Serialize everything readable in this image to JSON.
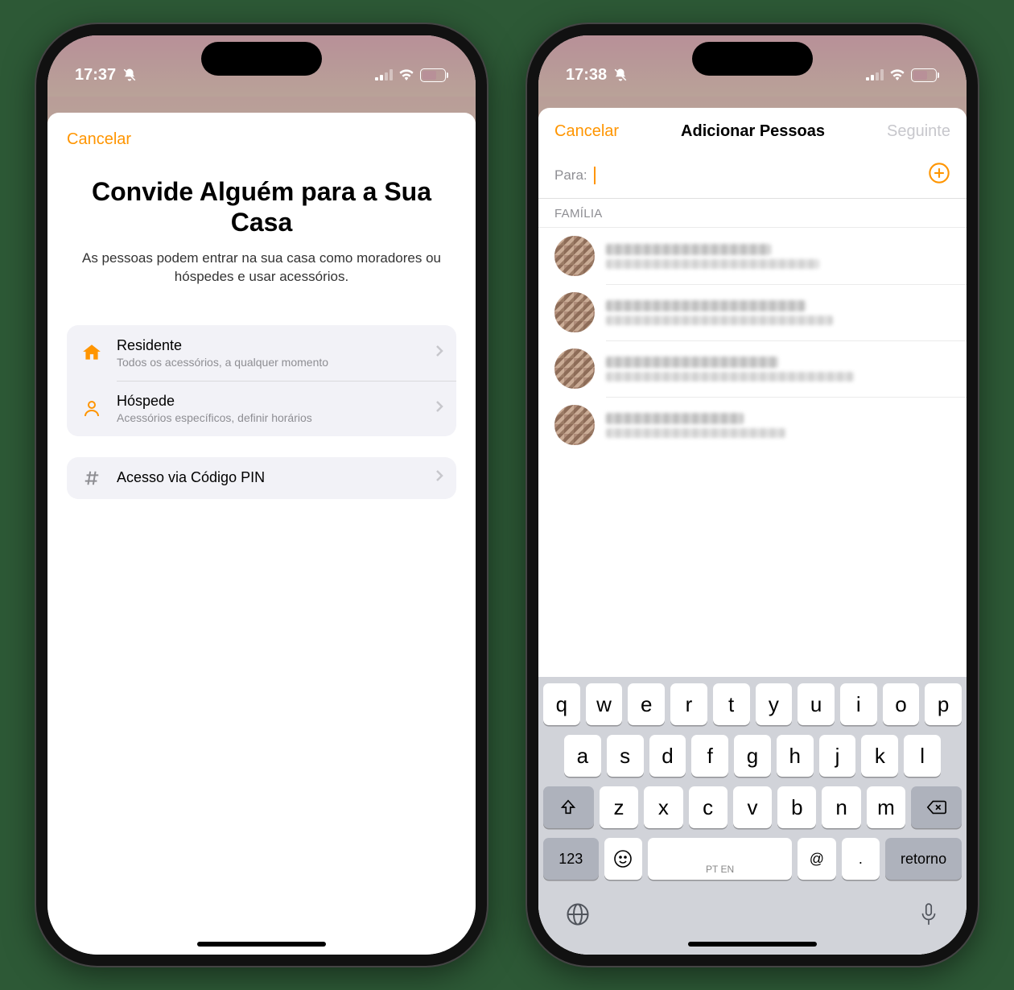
{
  "phone1": {
    "status": {
      "time": "17:37",
      "battery_pct": 64
    },
    "cancel": "Cancelar",
    "title": "Convide Alguém para a Sua Casa",
    "subtitle": "As pessoas podem entrar na sua casa como moradores ou hóspedes e usar acessórios.",
    "options": {
      "resident": {
        "title": "Residente",
        "sub": "Todos os acessórios, a qualquer momento"
      },
      "guest": {
        "title": "Hóspede",
        "sub": "Acessórios específicos, definir horários"
      },
      "pin": {
        "title": "Acesso via Código PIN"
      }
    }
  },
  "phone2": {
    "status": {
      "time": "17:38",
      "battery_pct": 64
    },
    "nav": {
      "cancel": "Cancelar",
      "title": "Adicionar Pessoas",
      "next": "Seguinte"
    },
    "to_label": "Para:",
    "section": "FAMÍLIA",
    "keyboard": {
      "row1": [
        "q",
        "w",
        "e",
        "r",
        "t",
        "y",
        "u",
        "i",
        "o",
        "p"
      ],
      "row2": [
        "a",
        "s",
        "d",
        "f",
        "g",
        "h",
        "j",
        "k",
        "l"
      ],
      "row3": [
        "z",
        "x",
        "c",
        "v",
        "b",
        "n",
        "m"
      ],
      "numKey": "123",
      "at": "@",
      "dot": ".",
      "spaceHint": "PT EN",
      "ret": "retorno"
    }
  }
}
